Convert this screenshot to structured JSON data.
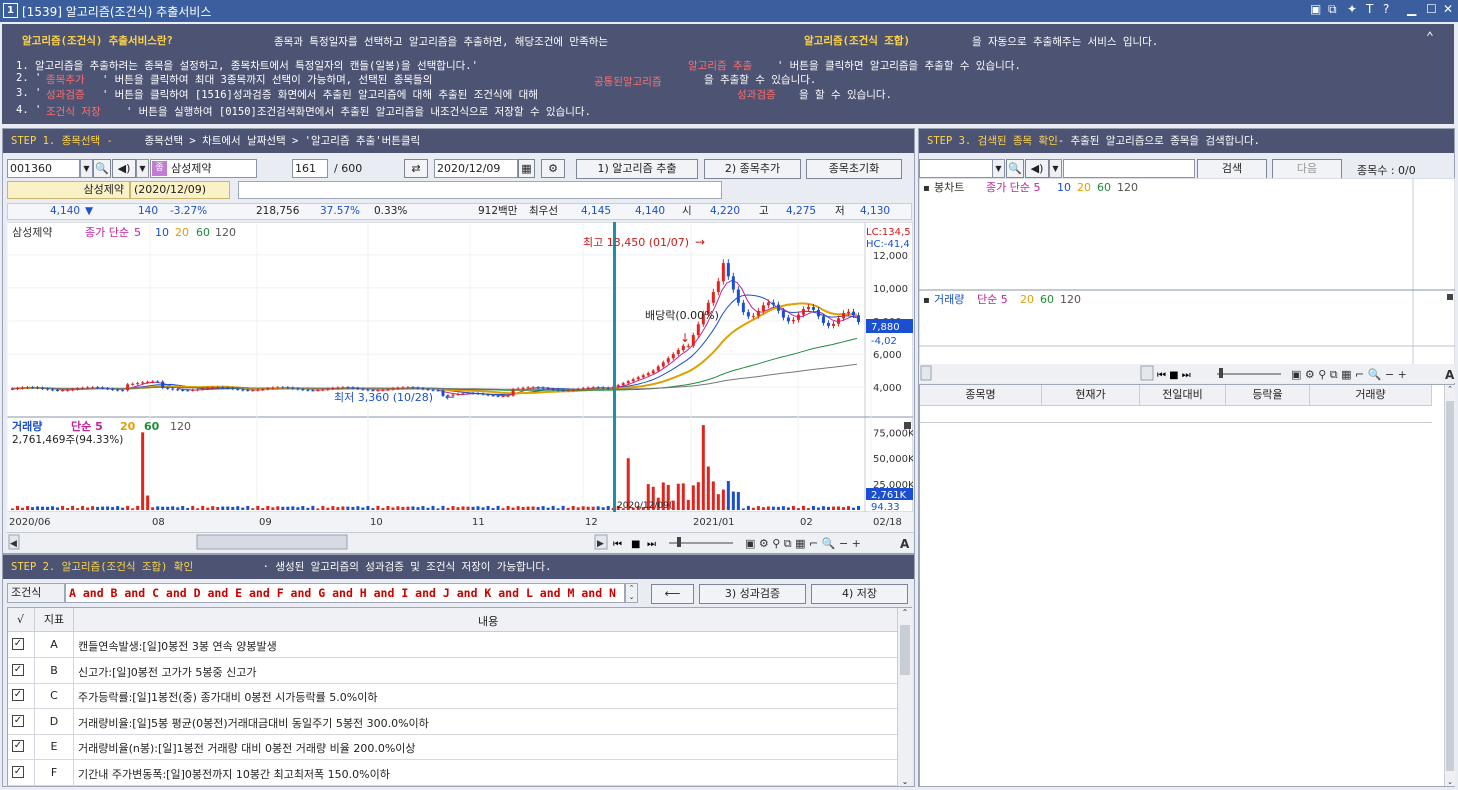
{
  "window": {
    "number": "1",
    "title": "[1539] 알고리즘(조건식) 추출서비스"
  },
  "info": {
    "q_label": "알고리즘(조건식) 추출서비스란?",
    "q_desc": "종목과 특정일자를 선택하고 알고리즘을 추출하면, 해당조건에 만족하는",
    "q_hl": "알고리즘(조건식 조합)",
    "q_tail": "을 자동으로 추출해주는 서비스 입니다.",
    "l1a": "1. 알고리즘을 추출하려는 종목을 설정하고, 종목차트에서 특정일자의 캔들(일봉)을 선택합니다.'",
    "l1b": "알고리즘 추출",
    "l1c": "' 버튼을 클릭하면 알고리즘을 추출할 수 있습니다.",
    "l2a": "2. '",
    "l2b": "종목추가",
    "l2c": "' 버튼을 클릭하여 최대 3종목까지 선택이 가능하며, 선택된 종목들의",
    "l2d": "공통된알고리즘",
    "l2e": "을 추출할 수 있습니다.",
    "l3a": "3. '",
    "l3b": "성과검증",
    "l3c": "' 버튼을 클릭하여 [1516]성과검증 화면에서 추출된 알고리즘에 대해 추출된 조건식에 대해",
    "l3d": "성과검증",
    "l3e": "을 할 수 있습니다.",
    "l4a": "4. '",
    "l4b": "조건식 저장",
    "l4c": "' 버튼을 실행하여 [0150]조건검색화면에서 추출된 알고리즘을 내조건식으로 저장할 수 있습니다."
  },
  "step1": {
    "title": "STEP 1. 종목선택 -",
    "desc": "종목선택 > 차트에서 날짜선택 > '알고리즘 추출'버튼클릭",
    "code": "001360",
    "name": "삼성제약",
    "count": "161",
    "total": "/ 600",
    "date": "2020/12/09",
    "btn_extract": "1) 알고리즘 추출",
    "btn_add": "2) 종목추가",
    "btn_reset": "종목초기화",
    "sel_name": "삼성제약",
    "sel_date": "(2020/12/09)"
  },
  "quote": {
    "price": "4,140",
    "arrow": "▼",
    "change": "140",
    "pct": "-3.27%",
    "volume": "218,756",
    "vol_pct": "37.57%",
    "turnover": "0.33%",
    "amount": "912백만",
    "best_label": "최우선",
    "best_ask": "4,145",
    "best_bid": "4,140",
    "open_label": "시",
    "open": "4,220",
    "high_label": "고",
    "high": "4,275",
    "low_label": "저",
    "low": "4,130"
  },
  "chart": {
    "legend": {
      "name": "삼성제약",
      "ma_label": "종가 단순",
      "ma5": "5",
      "ma10": "10",
      "ma20": "20",
      "ma60": "60",
      "ma120": "120"
    },
    "vol_legend": {
      "name": "거래량",
      "ma_label": "단순 5",
      "ma20": "20",
      "ma60": "60",
      "ma120": "120"
    },
    "vol_current": "2,761,469주(94.33%)",
    "max_label": "최고 13,450 (01/07)",
    "min_label": "최저 3,360 (10/28)",
    "div_label": "배당락(0.00%)",
    "lc": "LC:134,5",
    "hc": "HC:-41,4",
    "price_ticks": [
      "12,000",
      "10,000",
      "8,000",
      "6,000",
      "4,000"
    ],
    "price_box": "7,880",
    "price_neg": "-4,02",
    "vol_ticks": [
      "75,000K",
      "50,000K",
      "25,000K"
    ],
    "vol_box": "2,761K",
    "vol_pct_box": "94.33",
    "vol_mark": "2020/12/09(",
    "x_ticks": [
      "2020/06",
      "08",
      "09",
      "10",
      "11",
      "12",
      "2021/01",
      "02",
      "02/18"
    ],
    "btn_a": "A"
  },
  "chart_data": {
    "type": "candlestick",
    "x": [
      "2020/06",
      "08",
      "09",
      "10",
      "11",
      "12",
      "2021/01",
      "02",
      "02/18"
    ],
    "price_ylim": [
      2500,
      13500
    ],
    "volume_ylim": [
      0,
      85000
    ],
    "max": 13450,
    "min": 3360,
    "last": 7880
  },
  "step2": {
    "title": "STEP 2. 알고리즘(조건식 조합) 확인",
    "desc": "· 생성된 알고리즘의 성과검증 및 조건식 저장이 가능합니다.",
    "cond_label": "조건식",
    "cond_expr": "A and B and C and D and E and F and G and H and I and J and K and L and M and N",
    "btn_arrow": "⟵",
    "btn_verify": "3) 성과검증",
    "btn_save": "4) 저장",
    "col_check": "√",
    "col_ind": "지표",
    "col_content": "내용",
    "rows": [
      {
        "id": "A",
        "text": "캔들연속발생:[일]0봉전 3봉 연속 양봉발생"
      },
      {
        "id": "B",
        "text": "신고가:[일]0봉전 고가가 5봉중 신고가"
      },
      {
        "id": "C",
        "text": "주가등락률:[일]1봉전(중) 종가대비 0봉전 시가등락률 5.0%이하"
      },
      {
        "id": "D",
        "text": "거래량비율:[일]5봉 평균(0봉전)거래대금대비 동일주기 5봉전 300.0%이하"
      },
      {
        "id": "E",
        "text": "거래량비율(n봉):[일]1봉전 거래량 대비 0봉전 거래량 비율 200.0%이상"
      },
      {
        "id": "F",
        "text": "기간내 주가변동폭:[일]0봉전까지 10봉간 최고최저폭 150.0%이하"
      }
    ]
  },
  "step3": {
    "title": "STEP 3. 검색된 종목 확인",
    "desc": "- 추출된 알고리즘으로 종목을 검색합니다.",
    "btn_search": "검색",
    "btn_next": "다음",
    "count_label": "종목수 : 0/0",
    "legend": {
      "name": "봉차트",
      "ma_label": "종가 단순 5",
      "ma10": "10",
      "ma20": "20",
      "ma60": "60",
      "ma120": "120"
    },
    "vol_legend": {
      "name": "거래량",
      "ma_label": "단순 5",
      "ma20": "20",
      "ma60": "60",
      "ma120": "120"
    },
    "btn_a": "A",
    "columns": [
      "종목명",
      "현재가",
      "전일대비",
      "등락율",
      "거래량"
    ]
  },
  "colors": {
    "header": "#4d5373",
    "accent": "#ffd54a",
    "up": "#e0241e",
    "down": "#1b4fd1"
  }
}
